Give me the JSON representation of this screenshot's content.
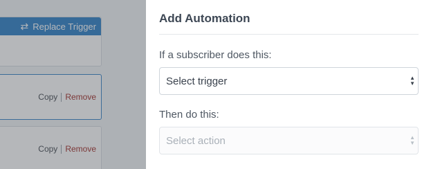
{
  "trigger_card": {
    "replace_label": "Replace Trigger",
    "icon": "sync-icon"
  },
  "action_cards": [
    {
      "copy_label": "Copy",
      "remove_label": "Remove"
    },
    {
      "copy_label": "Copy",
      "remove_label": "Remove"
    }
  ],
  "panel": {
    "title": "Add Automation",
    "trigger_label": "If a subscriber does this:",
    "trigger_select": {
      "value": "Select trigger"
    },
    "action_label": "Then do this:",
    "action_select": {
      "value": "Select action"
    }
  },
  "colors": {
    "accent_blue": "#3383c8",
    "remove_red": "#a3332e",
    "title_text": "#3d4754"
  }
}
